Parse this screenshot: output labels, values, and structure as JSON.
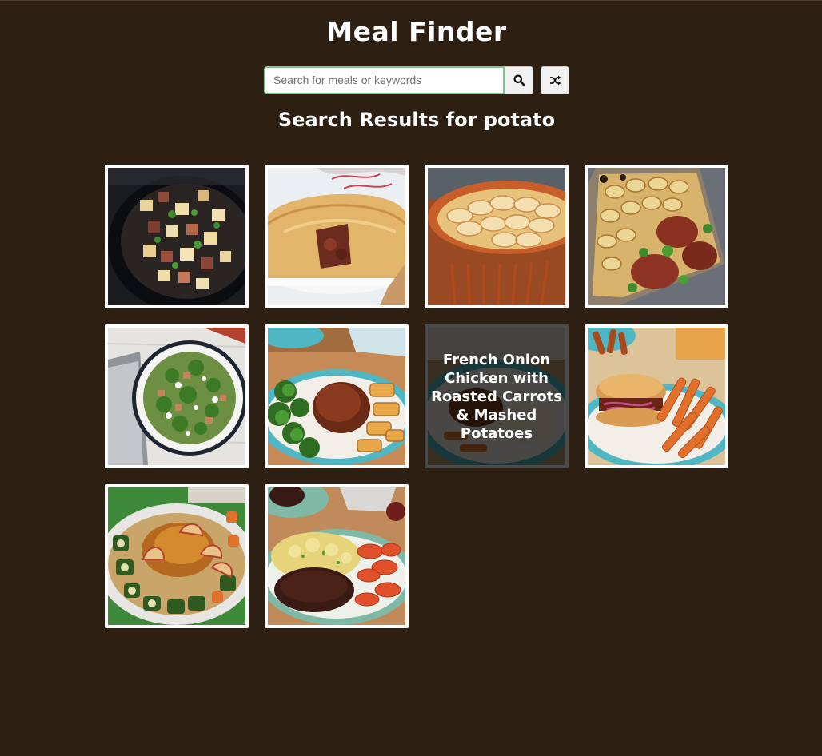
{
  "app": {
    "title": "Meal Finder"
  },
  "search": {
    "placeholder": "Search for meals or keywords",
    "value": "",
    "search_button_icon": "search-icon",
    "random_button_icon": "shuffle-icon"
  },
  "results": {
    "heading": "Search Results for potato",
    "hovered_meal_title": "French Onion Chicken with Roasted Carrots & Mashed Potatoes"
  },
  "colors": {
    "background": "#2d2013",
    "search_focus_border": "#7fc48c",
    "card_border": "#ffffff"
  }
}
